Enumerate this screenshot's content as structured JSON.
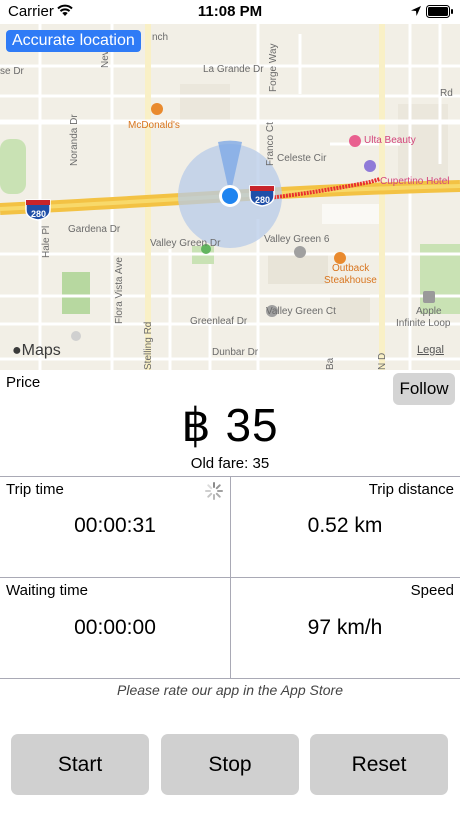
{
  "status_bar": {
    "carrier": "Carrier",
    "time": "11:08 PM"
  },
  "map": {
    "accurate_location_label": "Accurate location",
    "maps_logo": "Maps",
    "legal": "Legal",
    "labels": {
      "la_grande": "La Grande Dr",
      "forge_way": "Forge Way",
      "mcdonalds": "McDonald's",
      "ulta": "Ulta Beauty",
      "celeste": "Celeste Cir",
      "cupertino_hotel": "Cupertino Hotel",
      "franco_ct": "Franco Ct",
      "noranda": "Noranda Dr",
      "gardena": "Gardena Dr",
      "valley_green_dr": "Valley Green Dr",
      "valley_green_6": "Valley Green 6",
      "outback_1": "Outback",
      "outback_2": "Steakhouse",
      "apple_1": "Apple",
      "apple_2": "Infinite Loop",
      "hale_pl": "Hale Pl",
      "flora_vista": "Flora Vista Ave",
      "greenleaf": "Greenleaf Dr",
      "valley_green_ct": "Valley Green Ct",
      "dunbar": "Dunbar Dr",
      "stelling": "Stelling Rd",
      "n_de_anza": "N D",
      "ba": "Ba",
      "nevada": "Nev",
      "ranch": "nch",
      "se_ro": "se Dr",
      "rd": "Rd",
      "i280": "280"
    },
    "colors": {
      "accent": "#2f7bf6",
      "route": "#e8302e",
      "freeway": "#f6c844",
      "background": "#f2efe6",
      "park": "#c9e2b4"
    }
  },
  "price": {
    "label": "Price",
    "follow_button": "Follow",
    "value": "฿ 35",
    "old_fare": "Old fare: 35"
  },
  "stats": {
    "trip_time_label": "Trip time",
    "trip_time_value": "00:00:31",
    "trip_distance_label": "Trip distance",
    "trip_distance_value": "0.52 km",
    "waiting_time_label": "Waiting time",
    "waiting_time_value": "00:00:00",
    "speed_label": "Speed",
    "speed_value": "97 km/h"
  },
  "rate_text": "Please rate our app in the App Store",
  "buttons": {
    "start": "Start",
    "stop": "Stop",
    "reset": "Reset"
  }
}
